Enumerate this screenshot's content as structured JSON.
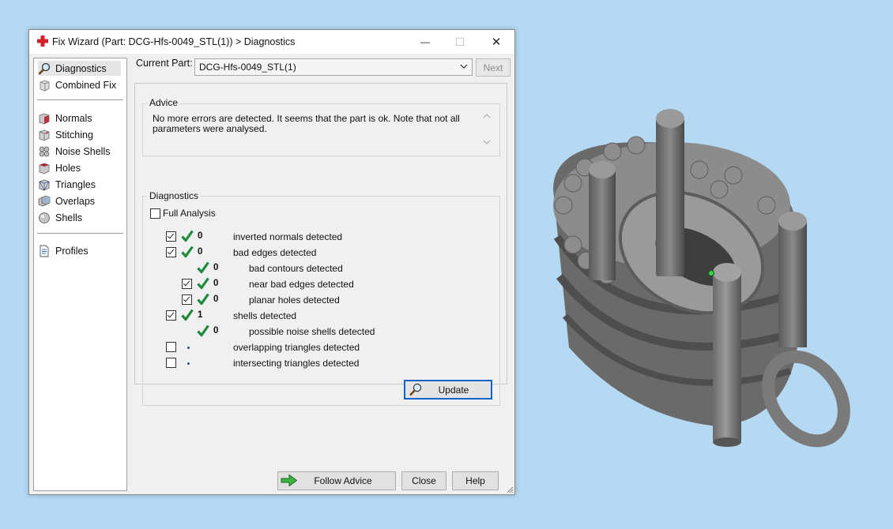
{
  "window": {
    "title": "Fix Wizard (Part: DCG-Hfs-0049_STL(1)) > Diagnostics",
    "minimize_glyph": "—",
    "maximize_glyph": "☐",
    "close_glyph": "✕"
  },
  "nav": {
    "items": [
      {
        "label": "Diagnostics",
        "icon": "magnifier-icon",
        "selected": true
      },
      {
        "label": "Combined Fix",
        "icon": "cube-icon"
      },
      {
        "label": "Normals",
        "icon": "normals-cube-icon"
      },
      {
        "label": "Stitching",
        "icon": "stitching-cube-icon"
      },
      {
        "label": "Noise Shells",
        "icon": "noise-shells-icon"
      },
      {
        "label": "Holes",
        "icon": "holes-cube-icon"
      },
      {
        "label": "Triangles",
        "icon": "triangles-cube-icon"
      },
      {
        "label": "Overlaps",
        "icon": "overlaps-icon"
      },
      {
        "label": "Shells",
        "icon": "shells-icon"
      },
      {
        "label": "Profiles",
        "icon": "document-icon"
      }
    ]
  },
  "header": {
    "current_part_label": "Current Part:",
    "current_part_value": "DCG-Hfs-0049_STL(1)",
    "next_label": "Next"
  },
  "advice": {
    "title": "Advice",
    "text": "No more errors are detected. It seems that the part is ok. Note that not all parameters were analysed."
  },
  "diagnostics": {
    "title": "Diagnostics",
    "full_analysis_label": "Full Analysis",
    "full_analysis_checked": false,
    "rows": [
      {
        "checked": true,
        "status": "ok",
        "count": "0",
        "label": "inverted normals detected",
        "level": 0
      },
      {
        "checked": true,
        "status": "ok",
        "count": "0",
        "label": "bad edges detected",
        "level": 0
      },
      {
        "checked": null,
        "status": "ok",
        "count": "0",
        "label": "bad contours detected",
        "level": 1
      },
      {
        "checked": true,
        "status": "ok",
        "count": "0",
        "label": "near bad edges detected",
        "level": 1
      },
      {
        "checked": true,
        "status": "ok",
        "count": "0",
        "label": "planar holes detected",
        "level": 1
      },
      {
        "checked": true,
        "status": "ok",
        "count": "1",
        "label": "shells detected",
        "level": 0
      },
      {
        "checked": null,
        "status": "ok",
        "count": "0",
        "label": "possible noise shells detected",
        "level": 1
      },
      {
        "checked": false,
        "status": "pending",
        "count": "",
        "label": "overlapping triangles detected",
        "level": 0
      },
      {
        "checked": false,
        "status": "pending",
        "count": "",
        "label": "intersecting triangles detected",
        "level": 0
      }
    ],
    "update_label": "Update"
  },
  "footer": {
    "follow_advice_label": "Follow Advice",
    "close_label": "Close",
    "help_label": "Help"
  },
  "colors": {
    "desktop": "#b5d9f3",
    "check_green": "#1e8a3c",
    "accent_blue": "#0a64c8"
  }
}
